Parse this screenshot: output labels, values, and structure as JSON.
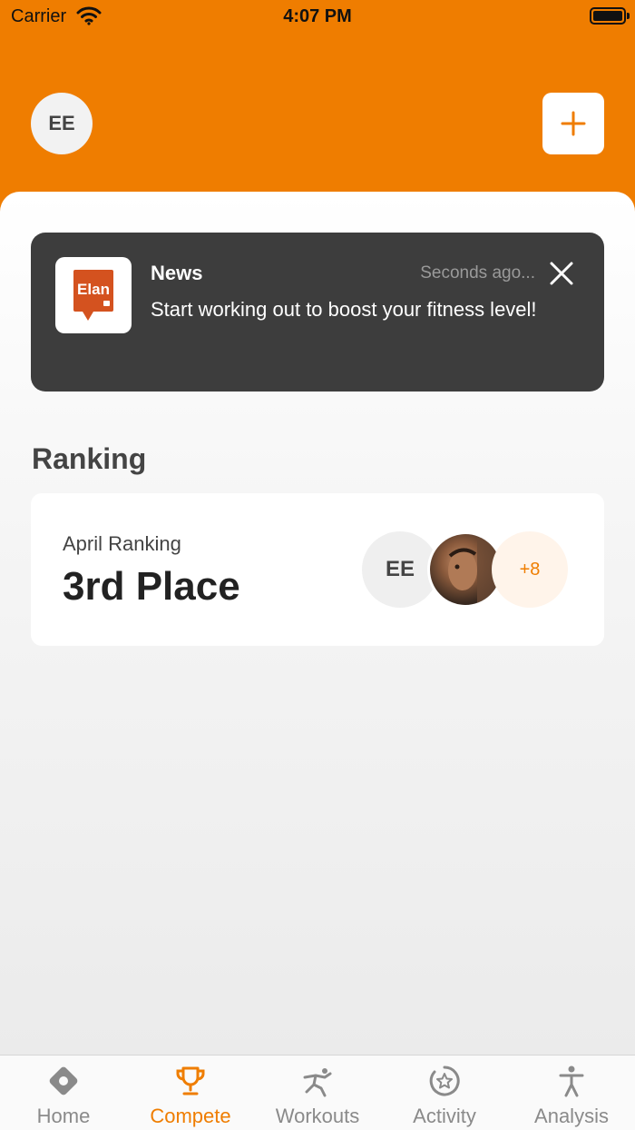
{
  "status_bar": {
    "carrier": "Carrier",
    "time": "4:07 PM"
  },
  "header": {
    "avatar_initials": "EE",
    "add_icon": "plus-icon"
  },
  "colors": {
    "accent": "#ef7d00",
    "card_dark": "#3d3d3d"
  },
  "news": {
    "logo_text": "Elan",
    "title": "News",
    "time": "Seconds ago...",
    "body": "Start working out to boost your fitness level!",
    "close_icon": "close-icon"
  },
  "ranking": {
    "section_title": "Ranking",
    "subtitle": "April Ranking",
    "place": "3rd Place",
    "participants": {
      "initials": "EE",
      "more": "+8"
    }
  },
  "tabs": [
    {
      "label": "Home",
      "icon": "home-icon",
      "active": false
    },
    {
      "label": "Compete",
      "icon": "trophy-icon",
      "active": true
    },
    {
      "label": "Workouts",
      "icon": "running-figure-icon",
      "active": false
    },
    {
      "label": "Activity",
      "icon": "star-badge-icon",
      "active": false
    },
    {
      "label": "Analysis",
      "icon": "person-icon",
      "active": false
    }
  ]
}
